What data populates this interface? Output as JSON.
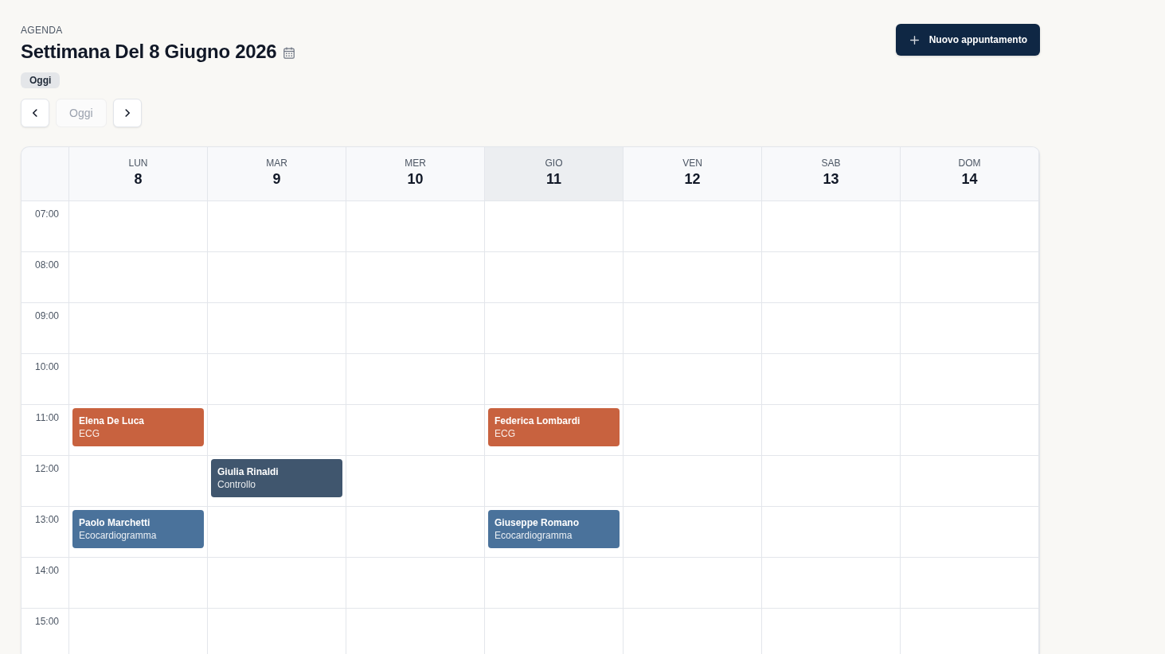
{
  "header": {
    "eyebrow": "AGENDA",
    "title": "Settimana Del 8 Giugno 2026",
    "today_badge": "Oggi",
    "new_button": {
      "label": "Nuovo appuntamento"
    }
  },
  "nav": {
    "today_button": {
      "label": "Oggi",
      "disabled": true
    }
  },
  "calendar": {
    "days": [
      {
        "weekday": "LUN",
        "date": "8",
        "today": false
      },
      {
        "weekday": "MAR",
        "date": "9",
        "today": false
      },
      {
        "weekday": "MER",
        "date": "10",
        "today": false
      },
      {
        "weekday": "GIO",
        "date": "11",
        "today": true
      },
      {
        "weekday": "VEN",
        "date": "12",
        "today": false
      },
      {
        "weekday": "SAB",
        "date": "13",
        "today": false
      },
      {
        "weekday": "DOM",
        "date": "14",
        "today": false
      }
    ],
    "rows": [
      {
        "time": "07:00",
        "cells": [
          {},
          {},
          {},
          {},
          {},
          {},
          {}
        ]
      },
      {
        "time": "08:00",
        "cells": [
          {},
          {},
          {},
          {},
          {},
          {},
          {}
        ]
      },
      {
        "time": "09:00",
        "cells": [
          {},
          {},
          {},
          {},
          {},
          {},
          {}
        ]
      },
      {
        "time": "10:00",
        "cells": [
          {},
          {},
          {},
          {},
          {},
          {},
          {}
        ]
      },
      {
        "time": "11:00",
        "cells": [
          {
            "appointment": {
              "patient": "Elena De Luca",
              "exam": "ECG",
              "color": "#c8623f"
            }
          },
          {},
          {},
          {
            "appointment": {
              "patient": "Federica Lombardi",
              "exam": "ECG",
              "color": "#c8623f"
            }
          },
          {},
          {},
          {}
        ]
      },
      {
        "time": "12:00",
        "cells": [
          {},
          {
            "appointment": {
              "patient": "Giulia Rinaldi",
              "exam": "Controllo",
              "color": "#40566e"
            }
          },
          {},
          {},
          {},
          {},
          {}
        ]
      },
      {
        "time": "13:00",
        "cells": [
          {
            "appointment": {
              "patient": "Paolo Marchetti",
              "exam": "Ecocardiogramma",
              "color": "#4a729b"
            }
          },
          {},
          {},
          {
            "appointment": {
              "patient": "Giuseppe Romano",
              "exam": "Ecocardiogramma",
              "color": "#4a729b"
            }
          },
          {},
          {},
          {}
        ]
      },
      {
        "time": "14:00",
        "cells": [
          {},
          {},
          {},
          {},
          {},
          {},
          {}
        ]
      },
      {
        "time": "15:00",
        "cells": [
          {},
          {},
          {},
          {},
          {},
          {},
          {}
        ]
      }
    ]
  }
}
